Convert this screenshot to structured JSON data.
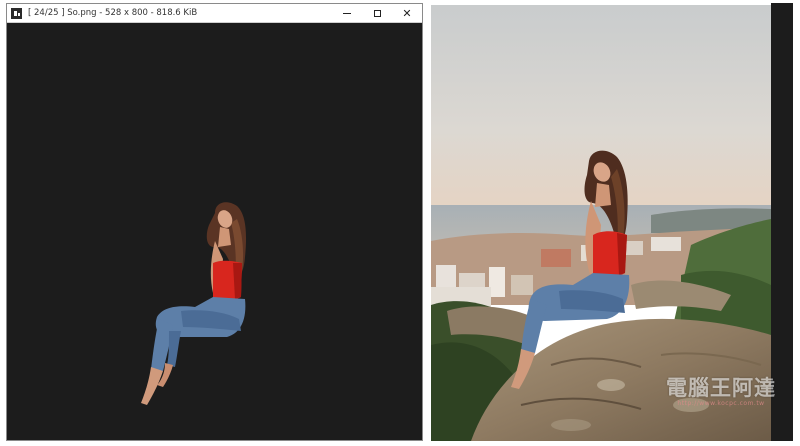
{
  "viewer": {
    "title": "[ 24/25 ]  So.png  -  528 x 800  -  818.6 KiB",
    "app_icon": "image-viewer-icon",
    "controls": {
      "minimize": "minimize-icon",
      "maximize": "maximize-icon",
      "close_label": "✕"
    },
    "background_color": "#1c1c1c"
  },
  "photo": {
    "subject": "woman-sitting-on-rock",
    "sky_color": "#d6d4d0",
    "sea_color": "#a9b0b4"
  },
  "watermark": {
    "title": "電腦王阿達",
    "subtitle": "http://www.kocpc.com.tw"
  }
}
